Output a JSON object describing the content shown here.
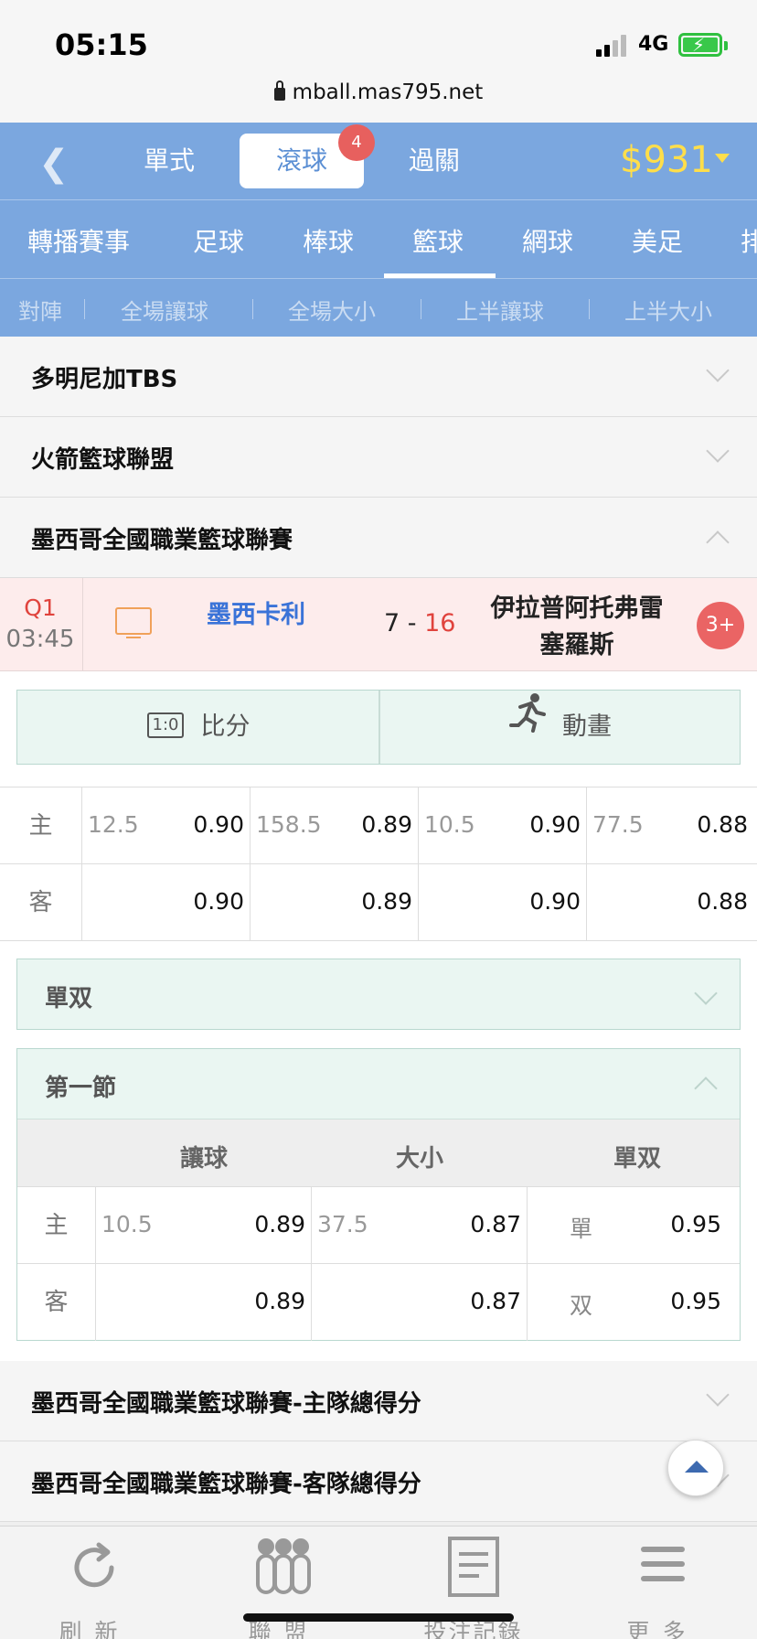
{
  "status": {
    "time": "05:15",
    "network": "4G",
    "url": "mball.mas795.net"
  },
  "header": {
    "mode_tabs": [
      {
        "label": "單式"
      },
      {
        "label": "滾球",
        "badge": "4"
      },
      {
        "label": "過關"
      }
    ],
    "balance": "$931"
  },
  "sports_tabs": [
    "轉播賽事",
    "足球",
    "棒球",
    "籃球",
    "網球",
    "美足",
    "排"
  ],
  "active_sport": "籃球",
  "market_tabs": [
    "對陣",
    "全場讓球",
    "全場大小",
    "上半讓球",
    "上半大小"
  ],
  "leagues": [
    {
      "name": "多明尼加TBS"
    },
    {
      "name": "火箭籃球聯盟"
    },
    {
      "name": "墨西哥全國職業籃球聯賽"
    }
  ],
  "match": {
    "period": "Q1",
    "clock": "03:45",
    "home_team": "墨西卡利",
    "home_score": "7",
    "score_sep": "-",
    "away_score": "16",
    "away_team_line1": "伊拉普阿托弗雷",
    "away_team_line2": "塞羅斯",
    "more": "3+"
  },
  "buttons": {
    "score_icon": "1:0",
    "score": "比分",
    "animation": "動畫"
  },
  "odds": {
    "home_label": "主",
    "away_label": "客",
    "home": [
      {
        "line": "12.5",
        "price": "0.90"
      },
      {
        "line": "158.5",
        "price": "0.89"
      },
      {
        "line": "10.5",
        "price": "0.90"
      },
      {
        "line": "77.5",
        "price": "0.88"
      }
    ],
    "away": [
      {
        "price": "0.90"
      },
      {
        "price": "0.89"
      },
      {
        "price": "0.90"
      },
      {
        "price": "0.88"
      }
    ]
  },
  "odd_even_box": {
    "title": "單双"
  },
  "quarter_box": {
    "title": "第一節",
    "columns": [
      "讓球",
      "大小",
      "單双"
    ],
    "home_label": "主",
    "away_label": "客",
    "home": {
      "hcap_line": "10.5",
      "hcap_price": "0.89",
      "ou_line": "37.5",
      "ou_price": "0.87",
      "oe_label": "單",
      "oe_price": "0.95"
    },
    "away": {
      "hcap_price": "0.89",
      "ou_price": "0.87",
      "oe_label": "双",
      "oe_price": "0.95"
    }
  },
  "bottom_leagues": [
    {
      "name": "墨西哥全國職業籃球聯賽-主隊總得分"
    },
    {
      "name": "墨西哥全國職業籃球聯賽-客隊總得分"
    }
  ],
  "bottom_nav": [
    {
      "label": "刷新",
      "icon": "refresh-icon"
    },
    {
      "label": "聯盟",
      "icon": "leagues-icon"
    },
    {
      "label": "投注記錄",
      "icon": "bet-history-icon"
    },
    {
      "label": "更多",
      "icon": "menu-icon"
    }
  ],
  "colors": {
    "header": "#7ba7df",
    "accent_red": "#e0433d",
    "balance": "#ffde4a",
    "team_blue": "#3a73d8"
  }
}
